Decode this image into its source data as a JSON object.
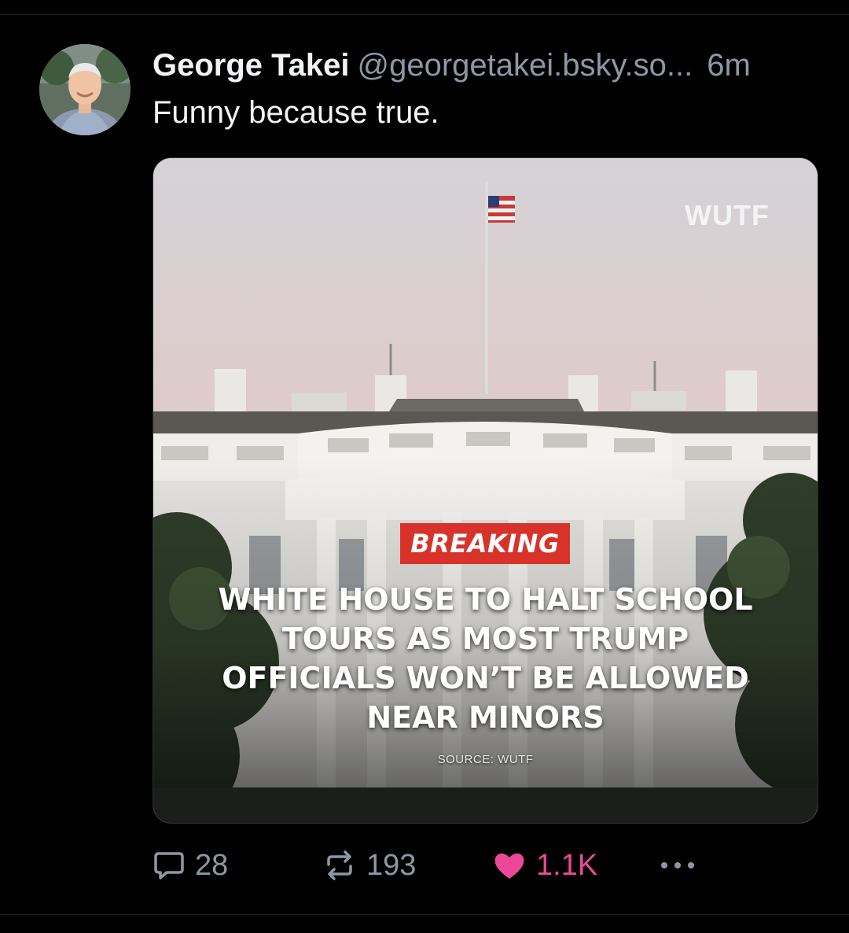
{
  "post": {
    "author": {
      "display_name": "George Takei",
      "handle": "@georgetakei.bsky.so...",
      "avatar_icon": "profile-photo"
    },
    "timestamp": "6m",
    "text": "Funny because true.",
    "media": {
      "watermark": "WUTF",
      "badge": "BREAKING",
      "headline": "WHITE HOUSE TO HALT SCHOOL TOURS AS MOST TRUMP OFFICIALS WON’T BE ALLOWED NEAR MINORS",
      "source": "SOURCE: WUTF",
      "badge_color": "#d8332b"
    },
    "actions": {
      "reply_count": "28",
      "repost_count": "193",
      "like_count": "1.1K",
      "reply_icon": "comment-bubble-icon",
      "repost_icon": "repost-arrows-icon",
      "like_icon": "heart-icon",
      "more_icon": "ellipsis-icon",
      "like_color": "#ec4899"
    }
  },
  "theme": {
    "background": "#000000",
    "muted_text": "#8b98a5",
    "primary_text": "#f1f3f5"
  }
}
